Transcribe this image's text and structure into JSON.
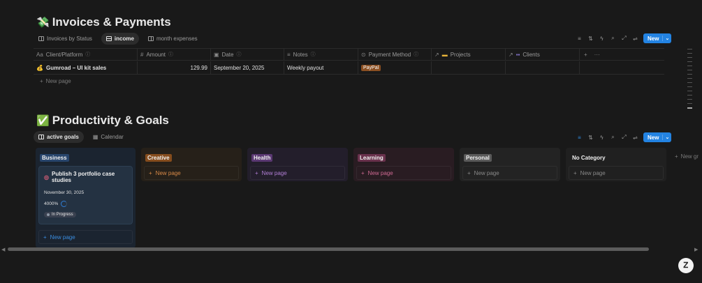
{
  "invoices": {
    "title_emoji": "💸",
    "title": "Invoices & Payments",
    "views": [
      {
        "label": "Invoices by Status",
        "active": false
      },
      {
        "label": "income",
        "active": true
      },
      {
        "label": "month expenses",
        "active": false
      }
    ],
    "new_label": "New",
    "columns": {
      "client": "Client/Platform",
      "amount": "Amount",
      "date": "Date",
      "notes": "Notes",
      "payment": "Payment Method",
      "projects": "Projects",
      "clients": "Clients"
    },
    "row": {
      "client": "Gumroad – UI kit sales",
      "amount": "129.99",
      "date": "September 20, 2025",
      "notes": "Weekly payout",
      "payment": "PayPal"
    },
    "new_page": "New page"
  },
  "goals": {
    "title_emoji": "✅",
    "title": "Productivity & Goals",
    "views": [
      {
        "label": "active goals",
        "active": true
      },
      {
        "label": "Calendar",
        "active": false
      }
    ],
    "new_label": "New",
    "columns": [
      {
        "label": "Business",
        "tag_color": "#28456c",
        "bg": "#1b2430",
        "new_color": "#3a8de0"
      },
      {
        "label": "Creative",
        "tag_color": "#854c1d",
        "bg": "#262019",
        "new_color": "#d98a48"
      },
      {
        "label": "Health",
        "tag_color": "#5a3872",
        "bg": "#231e2b",
        "new_color": "#b27fd6"
      },
      {
        "label": "Learning",
        "tag_color": "#69314c",
        "bg": "#291c22",
        "new_color": "#d06a94"
      },
      {
        "label": "Personal",
        "tag_color": "#5a5a5a",
        "bg": "#232323",
        "new_color": "#8a8a8a"
      },
      {
        "label": "No Category",
        "tag_color": "transparent",
        "bg": "#202020",
        "new_color": "#8a8a8a"
      }
    ],
    "card": {
      "title": "Publish 3 portfolio case studies",
      "date": "November 30, 2025",
      "progress": "4000%",
      "status": "In Progress"
    },
    "new_page": "New page",
    "new_group": "New gr"
  },
  "fab_label": "Ꮓ"
}
